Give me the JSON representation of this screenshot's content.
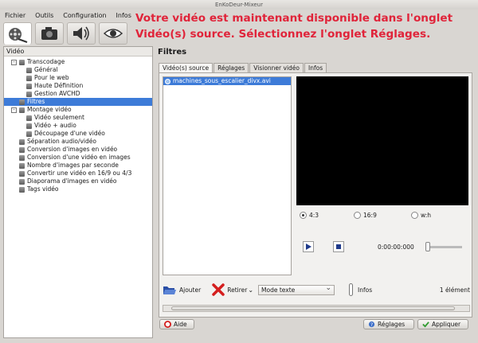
{
  "window": {
    "title": "EnKoDeur-Mixeur"
  },
  "menu": [
    "Fichier",
    "Outils",
    "Configuration",
    "Infos"
  ],
  "banner": {
    "line1": "Votre vidéo est maintenant disponible dans l'onglet",
    "line2": "Vidéo(s) source. Sélectionnez l'onglet Réglages."
  },
  "left_panel": {
    "title": "Vidéo",
    "tree": [
      {
        "label": "Transcodage",
        "level": 1,
        "expander": "-"
      },
      {
        "label": "Général",
        "level": 2
      },
      {
        "label": "Pour le web",
        "level": 2
      },
      {
        "label": "Haute Définition",
        "level": 2
      },
      {
        "label": "Gestion AVCHD",
        "level": 2
      },
      {
        "label": "Filtres",
        "level": 1,
        "selected": true
      },
      {
        "label": "Montage vidéo",
        "level": 1,
        "expander": "-"
      },
      {
        "label": "Vidéo seulement",
        "level": 2
      },
      {
        "label": "Vidéo + audio",
        "level": 2
      },
      {
        "label": "Découpage d'une vidéo",
        "level": 2
      },
      {
        "label": "Séparation audio/vidéo",
        "level": 1
      },
      {
        "label": "Conversion d'images en vidéo",
        "level": 1
      },
      {
        "label": "Conversion d'une vidéo en images",
        "level": 1
      },
      {
        "label": "Nombre d'images par seconde",
        "level": 1
      },
      {
        "label": "Convertir une vidéo en 16/9 ou 4/3",
        "level": 1
      },
      {
        "label": "Diaporama d'images en vidéo",
        "level": 1
      },
      {
        "label": "Tags vidéo",
        "level": 1
      }
    ]
  },
  "right_panel": {
    "title": "Filtres",
    "tabs": [
      "Vidéo(s) source",
      "Réglages",
      "Visionner vidéo",
      "Infos"
    ],
    "active_tab": 0,
    "file": "machines_sous_escalier_divx.avi",
    "ratios": [
      "4:3",
      "16:9",
      "w:h"
    ],
    "selected_ratio": "4:3",
    "time": "0:00:00:000",
    "add_label": "Ajouter",
    "remove_label": "Retirer",
    "mode_value": "Mode texte",
    "infos_label": "Infos",
    "count": "1 élément"
  },
  "footer": {
    "help": "Aide",
    "settings": "Réglages",
    "apply": "Appliquer"
  },
  "colors": {
    "banner": "#e0243a",
    "selection": "#3d7bd8"
  }
}
